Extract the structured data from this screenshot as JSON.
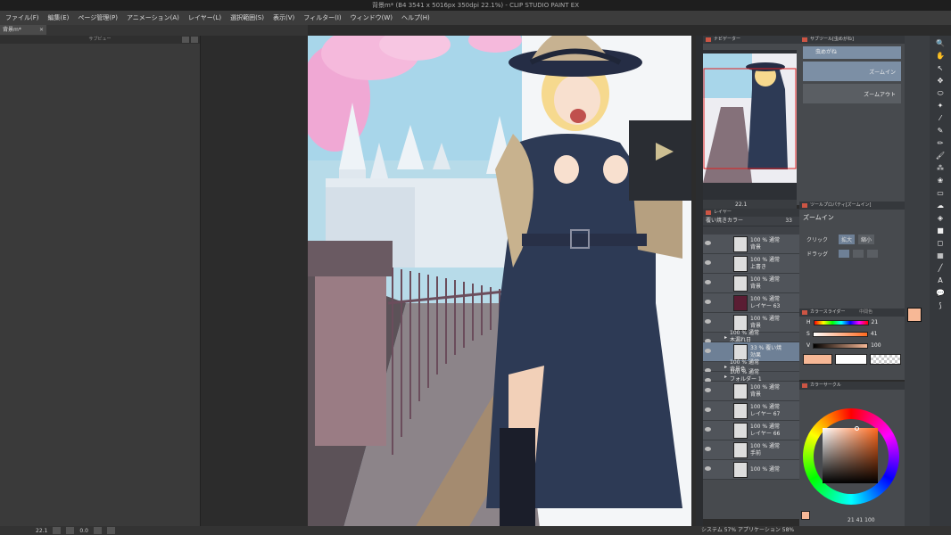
{
  "window": {
    "title": "背景m* (B4 3541 x 5016px 350dpi 22.1%) - CLIP STUDIO PAINT EX"
  },
  "menu": [
    "ファイル(F)",
    "編集(E)",
    "ページ管理(P)",
    "アニメーション(A)",
    "レイヤー(L)",
    "選択範囲(S)",
    "表示(V)",
    "フィルター(I)",
    "ウィンドウ(W)",
    "ヘルプ(H)"
  ],
  "doc_tab": {
    "label": "背景m*"
  },
  "left_panel": {
    "title": "サブビュー"
  },
  "navigator": {
    "title": "ナビゲーター",
    "zoom": "22.1"
  },
  "subtool": {
    "title": "サブツール[虫めがね]",
    "items": [
      {
        "label": "虫めがね",
        "icon": "magnifier-icon"
      },
      {
        "label": "ズームイン",
        "icon": "zoom-in-icon"
      },
      {
        "label": "ズームアウト",
        "icon": "zoom-out-icon"
      }
    ]
  },
  "tool_property": {
    "title": "ツールプロパティ[ズームイン]",
    "name": "ズームイン",
    "click_label": "クリック",
    "click_zoom_in": "拡大",
    "click_zoom_out": "縮小",
    "drag_label": "ドラッグ"
  },
  "layer_panel": {
    "title": "レイヤー",
    "blend_mode": "覆い焼きカラー",
    "opacity": "33",
    "layers": [
      {
        "text1": "100 % 通常",
        "text2": "背景",
        "type": "layer"
      },
      {
        "text1": "100 % 通常",
        "text2": "上書き",
        "type": "layer"
      },
      {
        "text1": "100 % 通常",
        "text2": "背景",
        "type": "layer"
      },
      {
        "text1": "100 % 通常",
        "text2": "レイヤー 63",
        "type": "layer",
        "thumb": "#5a1d33"
      },
      {
        "text1": "100 % 通常",
        "text2": "背景",
        "type": "layer"
      },
      {
        "text1": "100 % 通常",
        "text2": "木漏れ日",
        "type": "folder"
      },
      {
        "text1": "33 % 覆い焼",
        "text2": "効果",
        "type": "layer",
        "selected": true
      },
      {
        "text1": "100 % 通常",
        "text2": "背景色",
        "type": "folder"
      },
      {
        "text1": "100 % 通常",
        "text2": "フォルダー 1",
        "type": "folder"
      },
      {
        "text1": "100 % 通常",
        "text2": "背景",
        "type": "layer"
      },
      {
        "text1": "100 % 通常",
        "text2": "レイヤー 67",
        "type": "layer"
      },
      {
        "text1": "100 % 通常",
        "text2": "レイヤー 66",
        "type": "layer"
      },
      {
        "text1": "100 % 通常",
        "text2": "手前",
        "type": "layer"
      },
      {
        "text1": "100 % 通常",
        "text2": "",
        "type": "layer"
      }
    ]
  },
  "color_slider": {
    "title": "カラースライダー",
    "tab2": "中間色",
    "h_label": "H",
    "h_value": "21",
    "s_label": "S",
    "s_value": "41",
    "v_label": "V",
    "v_value": "100"
  },
  "color_wheel": {
    "title": "カラーサークル",
    "h": "21",
    "s": "41",
    "v": "100"
  },
  "status": {
    "zoom": "22.1",
    "angle": "0.0",
    "memory": "システム 57% アプリケーション 58%"
  },
  "colors": {
    "main": "#f7b896",
    "sub": "#ffffff",
    "accent": "#c8481f",
    "selected_layer": "#6e8096"
  }
}
